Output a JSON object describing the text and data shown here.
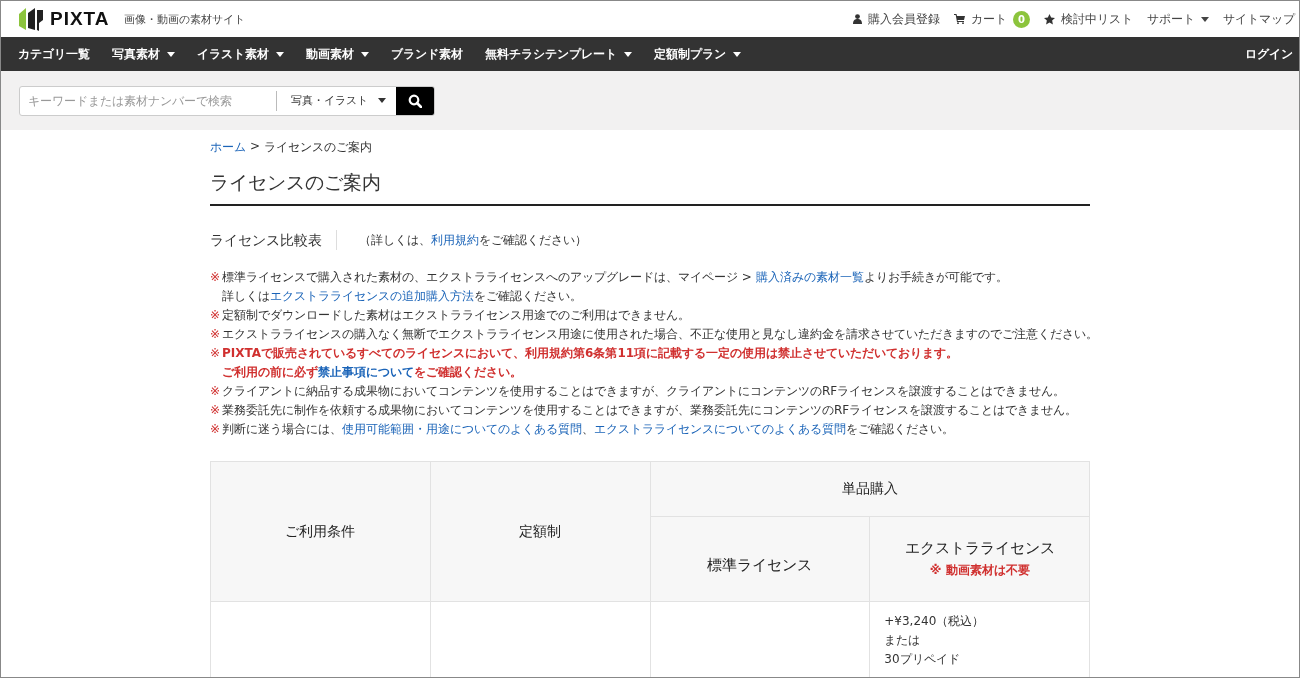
{
  "header": {
    "logo": "PIXTA",
    "tagline": "画像・動画の素材サイト",
    "links": [
      {
        "kind": "user",
        "label": "購入会員登録"
      },
      {
        "kind": "cart",
        "label": "カート",
        "badge": "0"
      },
      {
        "kind": "star",
        "label": "検討中リスト"
      },
      {
        "kind": "dropdown",
        "label": "サポート"
      },
      {
        "kind": "plain",
        "label": "サイトマップ"
      }
    ]
  },
  "nav": {
    "items": [
      {
        "label": "カテゴリ一覧",
        "dropdown": false
      },
      {
        "label": "写真素材",
        "dropdown": true
      },
      {
        "label": "イラスト素材",
        "dropdown": true
      },
      {
        "label": "動画素材",
        "dropdown": true
      },
      {
        "label": "ブランド素材",
        "dropdown": false
      },
      {
        "label": "無料チラシテンプレート",
        "dropdown": true
      },
      {
        "label": "定額制プラン",
        "dropdown": true
      }
    ],
    "login": "ログイン"
  },
  "search": {
    "placeholder": "キーワードまたは素材ナンバーで検索",
    "category": "写真・イラスト"
  },
  "breadcrumb": [
    {
      "label": "ホーム",
      "kind": "link"
    },
    {
      "label": ">",
      "kind": "text"
    },
    {
      "label": "ライセンスのご案内",
      "kind": "text"
    }
  ],
  "page_title": "ライセンスのご案内",
  "section": {
    "title": "ライセンス比較表",
    "note": [
      {
        "text": "（詳しくは、",
        "kind": "text"
      },
      {
        "text": "利用規約",
        "kind": "link"
      },
      {
        "text": "をご確認ください）",
        "kind": "text"
      }
    ]
  },
  "notes": [
    {
      "kind": "normal",
      "mark": "※",
      "lines": [
        [
          {
            "text": "標準ライセンスで購入された素材の、エクストラライセンスへのアップグレードは、マイページ > ",
            "kind": "text"
          },
          {
            "text": "購入済みの素材一覧",
            "kind": "link"
          },
          {
            "text": "よりお手続きが可能です。",
            "kind": "text"
          }
        ],
        [
          {
            "text": "詳しくは",
            "kind": "text"
          },
          {
            "text": "エクストラライセンスの追加購入方法",
            "kind": "link"
          },
          {
            "text": "をご確認ください。",
            "kind": "text"
          }
        ]
      ]
    },
    {
      "kind": "normal",
      "mark": "※",
      "lines": [
        [
          {
            "text": "定額制でダウンロードした素材はエクストラライセンス用途でのご利用はできません。",
            "kind": "text"
          }
        ]
      ]
    },
    {
      "kind": "normal",
      "mark": "※",
      "lines": [
        [
          {
            "text": "エクストラライセンスの購入なく無断でエクストラライセンス用途に使用された場合、不正な使用と見なし違約金を請求させていただきますのでご注意ください。",
            "kind": "text"
          }
        ]
      ]
    },
    {
      "kind": "warning",
      "mark": "※",
      "lines": [
        [
          {
            "text": "PIXTAで販売されているすべてのライセンスにおいて、利用規約第6条第11項に記載する一定の使用は禁止させていただいております。",
            "kind": "text"
          }
        ],
        [
          {
            "text": "ご利用の前に必ず",
            "kind": "text"
          },
          {
            "text": "禁止事項について",
            "kind": "link"
          },
          {
            "text": "をご確認ください。",
            "kind": "text"
          }
        ]
      ]
    },
    {
      "kind": "normal",
      "mark": "※",
      "lines": [
        [
          {
            "text": "クライアントに納品する成果物においてコンテンツを使用することはできますが、クライアントにコンテンツのRFライセンスを譲渡することはできません。",
            "kind": "text"
          }
        ]
      ]
    },
    {
      "kind": "normal",
      "mark": "※",
      "lines": [
        [
          {
            "text": "業務委託先に制作を依頼する成果物においてコンテンツを使用することはできますが、業務委託先にコンテンツのRFライセンスを譲渡することはできません。",
            "kind": "text"
          }
        ]
      ]
    },
    {
      "kind": "normal",
      "mark": "※",
      "lines": [
        [
          {
            "text": "判断に迷う場合には、",
            "kind": "text"
          },
          {
            "text": "使用可能範囲・用途についてのよくある質問",
            "kind": "link"
          },
          {
            "text": "、",
            "kind": "text"
          },
          {
            "text": "エクストラライセンスについてのよくある質問",
            "kind": "link"
          },
          {
            "text": "をご確認ください。",
            "kind": "text"
          }
        ]
      ]
    }
  ],
  "table": {
    "col_conditions": "ご利用条件",
    "col_subscription": "定額制",
    "group": "単品購入",
    "col_standard": "標準ライセンス",
    "col_extra": "エクストラライセンス",
    "col_extra_note": "※ 動画素材は不要",
    "row_extra_lines": [
      "+¥3,240（税込）",
      "または",
      "30プリペイド"
    ]
  }
}
